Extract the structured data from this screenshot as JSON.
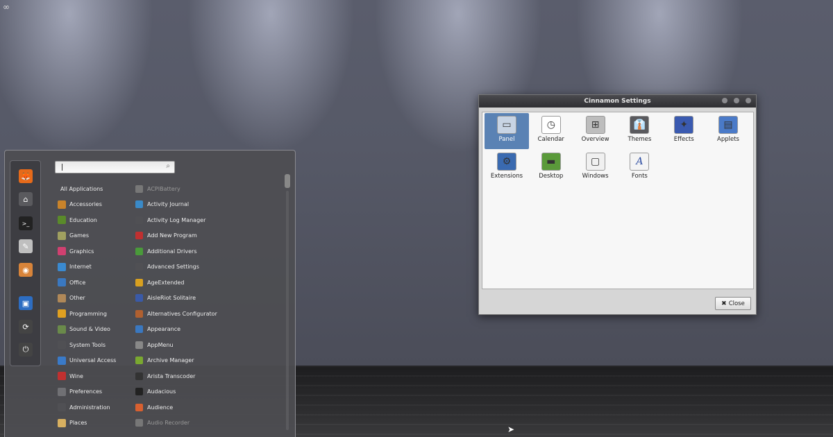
{
  "desktop": {
    "hot_corner_icon": "hot-corner-icon"
  },
  "menu": {
    "favorites": [
      {
        "icon": "firefox-icon",
        "color": "#e66a1a"
      },
      {
        "icon": "home-folder-icon",
        "color": "#5a5a5e"
      },
      {
        "icon": "terminal-icon",
        "color": "#222222"
      },
      {
        "icon": "text-editor-icon",
        "color": "#bfbfbf"
      },
      {
        "icon": "eye-of-gnome-icon",
        "color": "#d8843a"
      },
      {
        "icon": "computer-icon",
        "color": "#2d6dc2"
      },
      {
        "icon": "logout-icon",
        "color": "#444444"
      },
      {
        "icon": "power-icon",
        "color": "#444444"
      }
    ],
    "categories": [
      {
        "label": "All Applications",
        "color": ""
      },
      {
        "label": "Accessories",
        "color": "#c9832a"
      },
      {
        "label": "Education",
        "color": "#5a8a2a"
      },
      {
        "label": "Games",
        "color": "#a0a060"
      },
      {
        "label": "Graphics",
        "color": "#d04070"
      },
      {
        "label": "Internet",
        "color": "#3a8ad0"
      },
      {
        "label": "Office",
        "color": "#3a78c0"
      },
      {
        "label": "Other",
        "color": "#b08858"
      },
      {
        "label": "Programming",
        "color": "#e0a020"
      },
      {
        "label": "Sound & Video",
        "color": "#6a8a4a"
      },
      {
        "label": "System Tools",
        "color": "#505054"
      },
      {
        "label": "Universal Access",
        "color": "#3a7ac8"
      },
      {
        "label": "Wine",
        "color": "#c03030"
      },
      {
        "label": "Preferences",
        "color": "#707074"
      },
      {
        "label": "Administration",
        "color": "#505054"
      },
      {
        "label": "Places",
        "color": "#d8b060"
      }
    ],
    "applications": [
      {
        "label": "ACPIBattery",
        "color": "#777777",
        "dim": true
      },
      {
        "label": "Activity Journal",
        "color": "#3a8ac8",
        "dim": false
      },
      {
        "label": "Activity Log Manager",
        "color": "#505054",
        "dim": false
      },
      {
        "label": "Add New Program",
        "color": "#c03030",
        "dim": false
      },
      {
        "label": "Additional Drivers",
        "color": "#4a9a3a",
        "dim": false
      },
      {
        "label": "Advanced Settings",
        "color": "#505054",
        "dim": false
      },
      {
        "label": "AgeExtended",
        "color": "#d8a020",
        "dim": false
      },
      {
        "label": "AisleRiot Solitaire",
        "color": "#3a5aa8",
        "dim": false
      },
      {
        "label": "Alternatives Configurator",
        "color": "#b06030",
        "dim": false
      },
      {
        "label": "Appearance",
        "color": "#3a78c0",
        "dim": false
      },
      {
        "label": "AppMenu",
        "color": "#888888",
        "dim": false
      },
      {
        "label": "Archive Manager",
        "color": "#7aa830",
        "dim": false
      },
      {
        "label": "Arista Transcoder",
        "color": "#333333",
        "dim": false
      },
      {
        "label": "Audacious",
        "color": "#222222",
        "dim": false
      },
      {
        "label": "Audience",
        "color": "#d86030",
        "dim": false
      },
      {
        "label": "Audio Recorder",
        "color": "#777777",
        "dim": true
      }
    ]
  },
  "settings_window": {
    "title": "Cinnamon Settings",
    "items": [
      {
        "label": "Panel",
        "icon": "panel-icon",
        "color": "#c8d4e4",
        "selected": true
      },
      {
        "label": "Calendar",
        "icon": "clock-icon",
        "color": "#ffffff",
        "selected": false
      },
      {
        "label": "Overview",
        "icon": "overview-icon",
        "color": "#bdbdbd",
        "selected": false
      },
      {
        "label": "Themes",
        "icon": "themes-icon",
        "color": "#5a5a5e",
        "selected": false
      },
      {
        "label": "Effects",
        "icon": "effects-icon",
        "color": "#3a5ab0",
        "selected": false
      },
      {
        "label": "Applets",
        "icon": "applets-icon",
        "color": "#4a7ac8",
        "selected": false
      },
      {
        "label": "Extensions",
        "icon": "extensions-icon",
        "color": "#3a6ab0",
        "selected": false
      },
      {
        "label": "Desktop",
        "icon": "desktop-icon",
        "color": "#5a9a3a",
        "selected": false
      },
      {
        "label": "Windows",
        "icon": "windows-icon",
        "color": "#f0f0f0",
        "selected": false
      },
      {
        "label": "Fonts",
        "icon": "fonts-icon",
        "color": "#f4f4f4",
        "selected": false
      }
    ],
    "close_label": "Close"
  }
}
